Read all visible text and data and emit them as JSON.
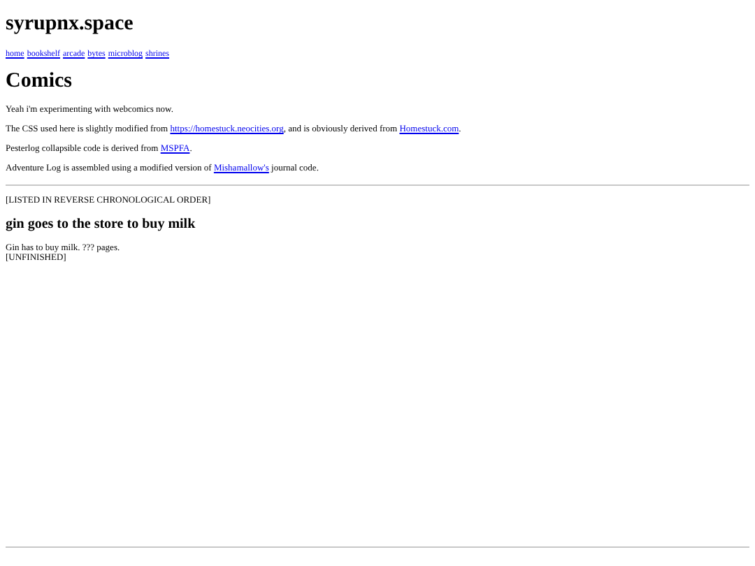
{
  "site_title": "syrupnx.space",
  "nav": [
    "home",
    "bookshelf",
    "arcade",
    "bytes",
    "microblog",
    "shrines"
  ],
  "page_heading": "Comics",
  "intro": [
    {
      "parts": [
        {
          "kind": "text",
          "text": "Yeah i'm experimenting with webcomics now."
        }
      ]
    },
    {
      "parts": [
        {
          "kind": "text",
          "text": "The CSS used here is slightly modified from "
        },
        {
          "kind": "link",
          "text": "https://homestuck.neocities.org"
        },
        {
          "kind": "text",
          "text": ", and is obviously derived from "
        },
        {
          "kind": "link",
          "text": "Homestuck.com"
        },
        {
          "kind": "text",
          "text": "."
        }
      ]
    },
    {
      "parts": [
        {
          "kind": "text",
          "text": "Pesterlog collapsible code is derived from "
        },
        {
          "kind": "link",
          "text": "MSPFA"
        },
        {
          "kind": "text",
          "text": "."
        }
      ]
    },
    {
      "parts": [
        {
          "kind": "text",
          "text": "Adventure Log is assembled using a modified version of "
        },
        {
          "kind": "link",
          "text": "Mishamallow's"
        },
        {
          "kind": "text",
          "text": " journal code."
        }
      ]
    }
  ],
  "list_note": "[LISTED IN REVERSE CHRONOLOGICAL ORDER]",
  "comics": [
    {
      "title": "gin goes to the store to buy milk",
      "description": "Gin has to buy milk. ??? pages.",
      "status": "[UNFINISHED]"
    }
  ]
}
